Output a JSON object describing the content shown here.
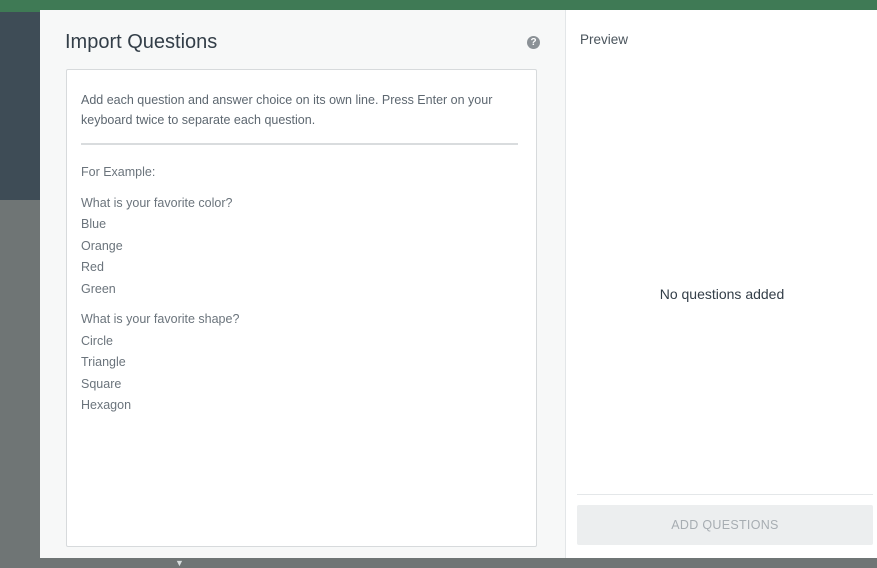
{
  "modal": {
    "title": "Import Questions",
    "help_icon": "question-circle-icon"
  },
  "editor": {
    "instructions": "Add each question and answer choice on its own line. Press Enter on your keyboard twice to separate each question.",
    "example_label": "For Example:",
    "example_groups": [
      {
        "question": "What is your favorite color?",
        "answers": [
          "Blue",
          "Orange",
          "Red",
          "Green"
        ]
      },
      {
        "question": "What is your favorite shape?",
        "answers": [
          "Circle",
          "Triangle",
          "Square",
          "Hexagon"
        ]
      }
    ]
  },
  "preview": {
    "label": "Preview",
    "empty_message": "No questions added",
    "add_button_label": "ADD QUESTIONS"
  },
  "colors": {
    "title": "#333e48",
    "text_muted": "#6b747c",
    "button_disabled_bg": "#eceeef",
    "button_disabled_text": "#a7adb2"
  }
}
